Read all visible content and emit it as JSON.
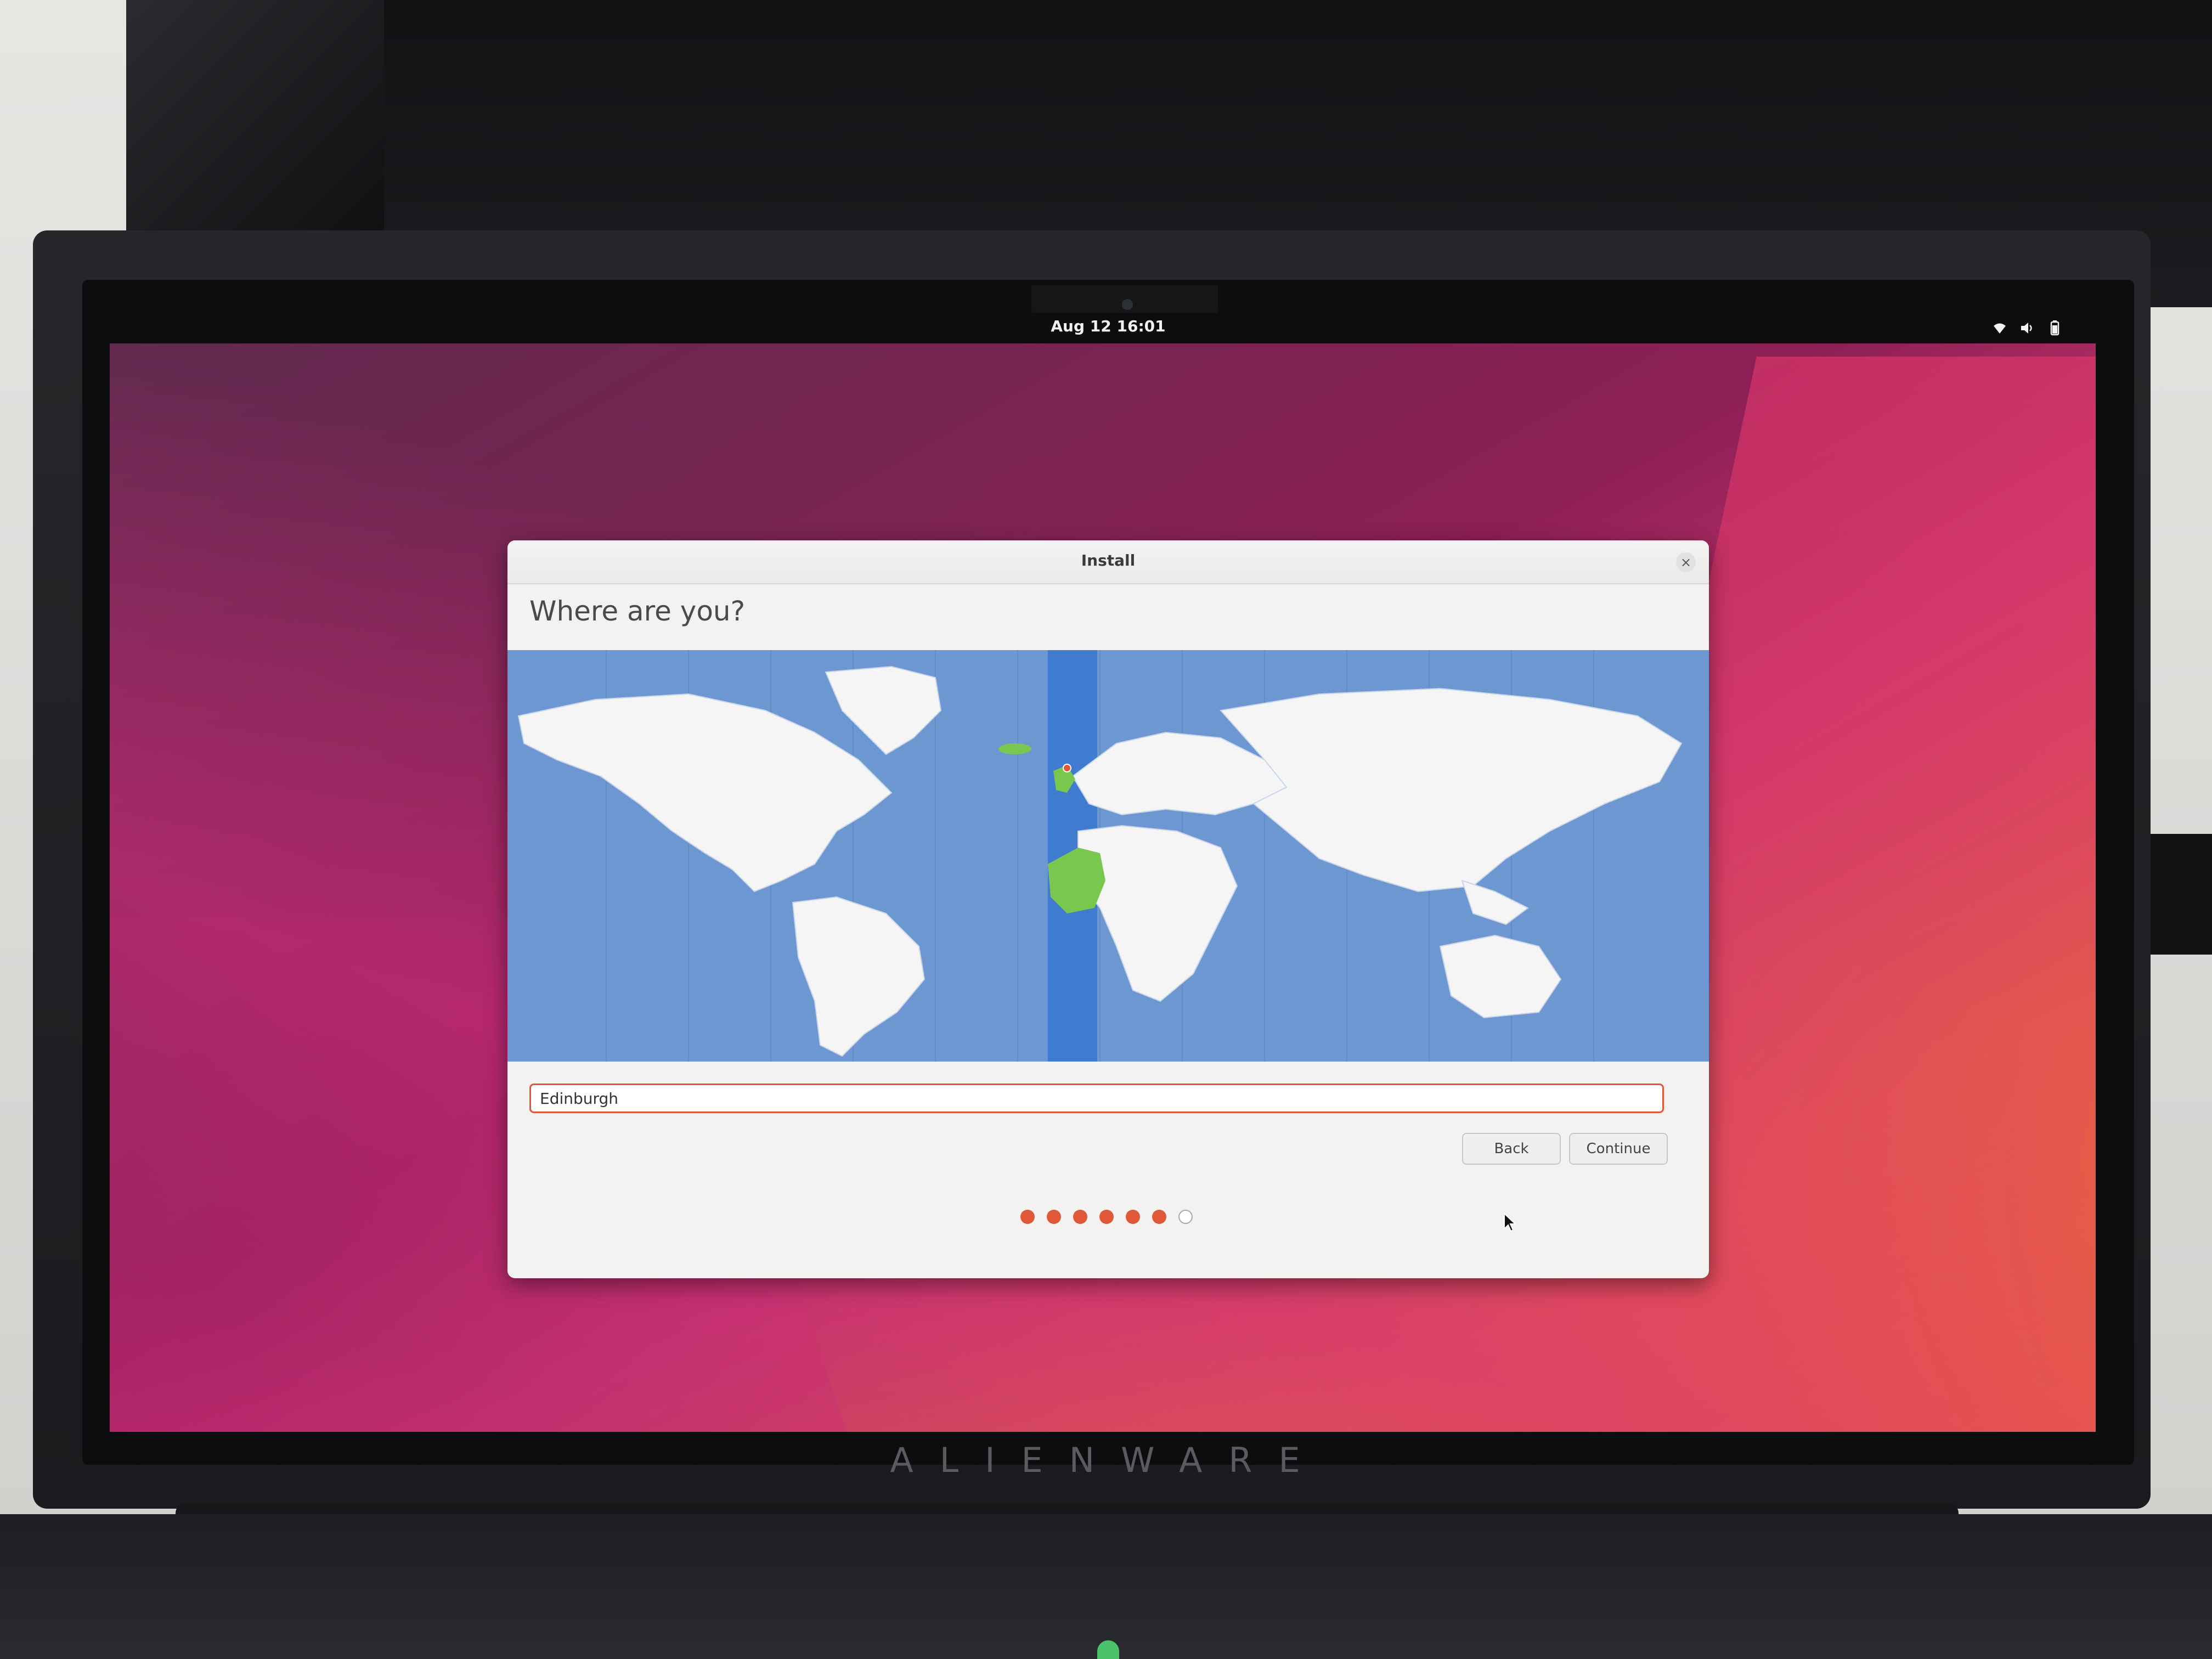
{
  "top_bar": {
    "clock": "Aug 12  16:01",
    "tray_icons": [
      "wifi-icon",
      "volume-icon",
      "battery-icon"
    ]
  },
  "window": {
    "title": "Install",
    "heading": "Where are you?",
    "location_value": "Edinburgh",
    "buttons": {
      "back": "Back",
      "continue": "Continue"
    },
    "progress": {
      "total_steps": 7,
      "completed_steps": 6
    }
  },
  "hardware": {
    "brand": "ALIENWARE"
  },
  "colors": {
    "accent": "#e0573a",
    "map_ocean": "#6d97d0",
    "map_land": "#f5f5f5",
    "selected_timezone_band": "#3f7bcf",
    "selected_region": "#7ac74f"
  }
}
